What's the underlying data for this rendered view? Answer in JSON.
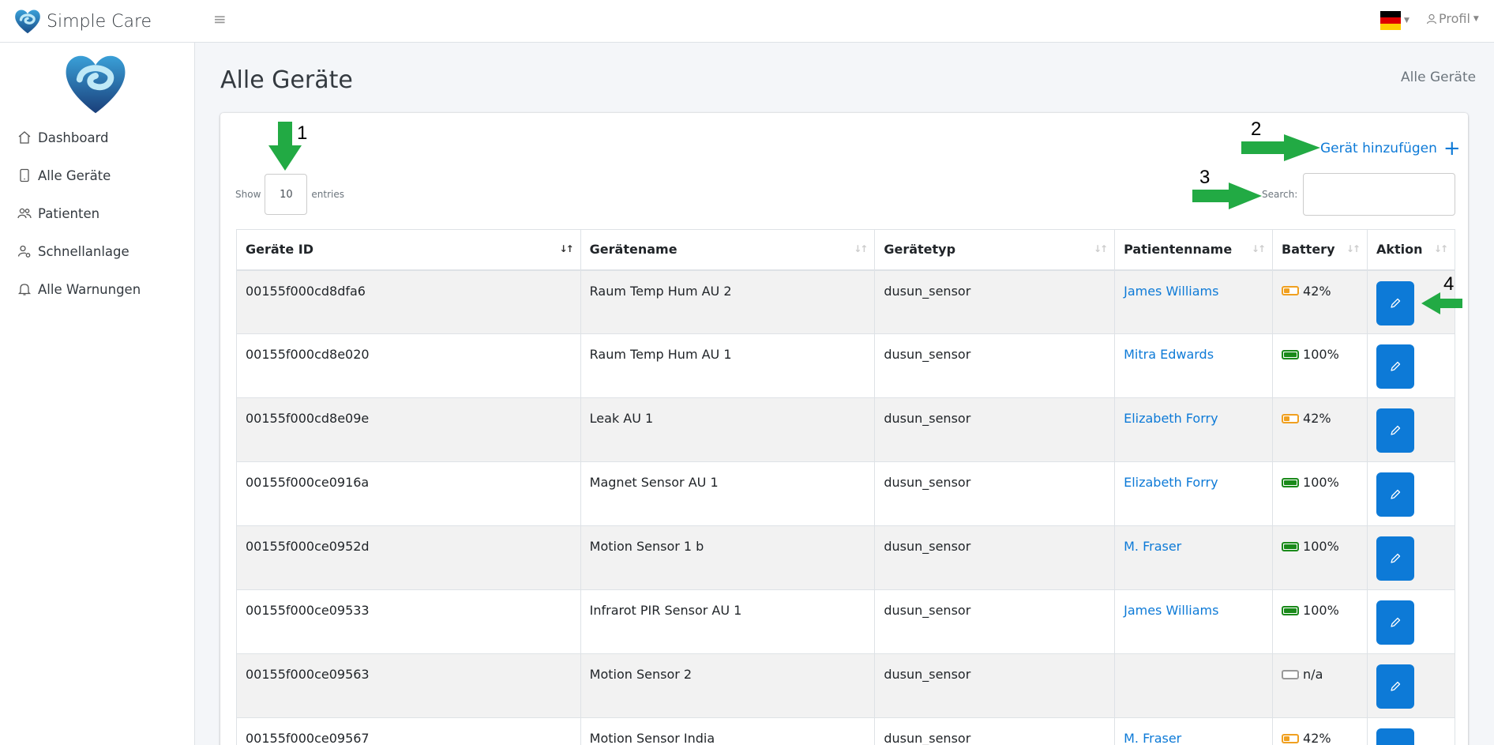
{
  "app": {
    "name": "Simple Care"
  },
  "header": {
    "menu_icon": "≡",
    "language": "de",
    "profile_label": "Profil"
  },
  "sidebar": {
    "items": [
      {
        "label": "Dashboard",
        "icon": "home-icon"
      },
      {
        "label": "Alle Geräte",
        "icon": "tablet-icon"
      },
      {
        "label": "Patienten",
        "icon": "users-icon"
      },
      {
        "label": "Schnellanlage",
        "icon": "user-cog-icon"
      },
      {
        "label": "Alle Warnungen",
        "icon": "bell-icon"
      }
    ]
  },
  "page": {
    "title": "Alle Geräte",
    "breadcrumb": "Alle Geräte"
  },
  "toolbar": {
    "add_label": "Gerät hinzufügen",
    "show_label": "Show",
    "entries_value": "10",
    "entries_label": "entries",
    "search_label": "Search:",
    "search_value": ""
  },
  "table": {
    "headers": [
      "Geräte ID",
      "Gerätename",
      "Gerätetyp",
      "Patientenname",
      "Battery",
      "Aktion"
    ],
    "rows": [
      {
        "id": "00155f000cd8dfa6",
        "name": "Raum Temp Hum AU 2",
        "type": "dusun_sensor",
        "patient": "James Williams",
        "battery": "42%",
        "battery_level": 0.42
      },
      {
        "id": "00155f000cd8e020",
        "name": "Raum Temp Hum AU 1",
        "type": "dusun_sensor",
        "patient": "Mitra Edwards",
        "battery": "100%",
        "battery_level": 1.0
      },
      {
        "id": "00155f000cd8e09e",
        "name": "Leak AU 1",
        "type": "dusun_sensor",
        "patient": "Elizabeth Forry",
        "battery": "42%",
        "battery_level": 0.42
      },
      {
        "id": "00155f000ce0916a",
        "name": "Magnet Sensor AU 1",
        "type": "dusun_sensor",
        "patient": "Elizabeth Forry",
        "battery": "100%",
        "battery_level": 1.0
      },
      {
        "id": "00155f000ce0952d",
        "name": "Motion Sensor 1 b",
        "type": "dusun_sensor",
        "patient": "M. Fraser",
        "battery": "100%",
        "battery_level": 1.0
      },
      {
        "id": "00155f000ce09533",
        "name": "Infrarot PIR Sensor AU 1",
        "type": "dusun_sensor",
        "patient": "James Williams",
        "battery": "100%",
        "battery_level": 1.0
      },
      {
        "id": "00155f000ce09563",
        "name": "Motion Sensor 2",
        "type": "dusun_sensor",
        "patient": "",
        "battery": "n/a",
        "battery_level": 0
      },
      {
        "id": "00155f000ce09567",
        "name": "Motion Sensor India",
        "type": "dusun_sensor",
        "patient": "M. Fraser",
        "battery": "42%",
        "battery_level": 0.42
      }
    ]
  },
  "annotations": [
    "1",
    "2",
    "3",
    "4"
  ],
  "colors": {
    "accent": "#0d7ad7",
    "battery_full": "#1a8a1a",
    "battery_mid": "#f0a020",
    "battery_na": "#999999",
    "arrow": "#22aa44"
  }
}
